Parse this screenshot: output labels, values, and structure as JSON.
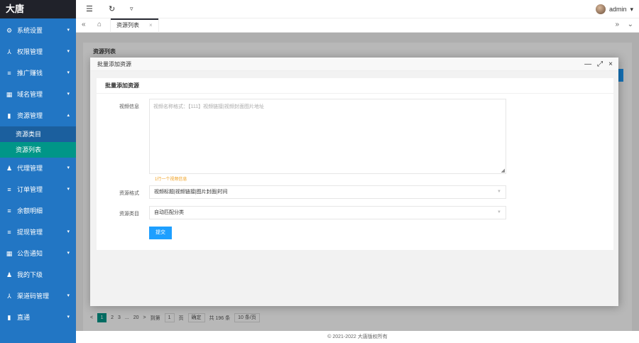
{
  "app": {
    "logo": "大唐"
  },
  "sidebar": {
    "items": [
      {
        "label": "系统设置",
        "icon": "gear-icon",
        "glyph": "⚙",
        "arrow": "▾"
      },
      {
        "label": "权限管理",
        "icon": "users-icon",
        "glyph": "⅄",
        "arrow": "▾"
      },
      {
        "label": "推广赚钱",
        "icon": "list-icon",
        "glyph": "≡",
        "arrow": "▾"
      },
      {
        "label": "域名管理",
        "icon": "grid-icon",
        "glyph": "▦",
        "arrow": "▾"
      },
      {
        "label": "资源管理",
        "icon": "file-icon",
        "glyph": "▮",
        "arrow": "▴"
      },
      {
        "label": "代理管理",
        "icon": "person-icon",
        "glyph": "♟",
        "arrow": "▾"
      },
      {
        "label": "订单管理",
        "icon": "list-icon",
        "glyph": "≡",
        "arrow": "▾"
      },
      {
        "label": "余额明细",
        "icon": "list-icon",
        "glyph": "≡",
        "arrow": ""
      },
      {
        "label": "提现管理",
        "icon": "list-icon",
        "glyph": "≡",
        "arrow": "▾"
      },
      {
        "label": "公告通知",
        "icon": "apps-icon",
        "glyph": "▦",
        "arrow": "▾"
      },
      {
        "label": "我的下级",
        "icon": "person-icon",
        "glyph": "♟",
        "arrow": ""
      },
      {
        "label": "渠道码管理",
        "icon": "users-icon",
        "glyph": "⅄",
        "arrow": "▾"
      },
      {
        "label": "直通",
        "icon": "file-icon",
        "glyph": "▮",
        "arrow": "▾"
      }
    ],
    "sub_items": [
      {
        "label": "资源类目"
      },
      {
        "label": "资源列表"
      }
    ]
  },
  "header": {
    "menu_glyph": "☰",
    "refresh_glyph": "↻",
    "clear_glyph": "▿",
    "user": "admin",
    "user_caret": "▾"
  },
  "tabs": {
    "prev_glyph": "«",
    "home_glyph": "⌂",
    "next_glyph": "»",
    "more_glyph": "⌄",
    "active": {
      "label": "资源列表",
      "close": "×"
    }
  },
  "background": {
    "title": "资源列表",
    "pager": {
      "prev": "<",
      "pages": [
        "1",
        "2",
        "3",
        "...",
        "20"
      ],
      "next": ">",
      "goto_label": "到第",
      "goto_value": "1",
      "page_unit": "页",
      "confirm": "确定",
      "total": "共 196 条",
      "page_size": "10 条/页"
    }
  },
  "footer": {
    "text": "© 2021-2022 大唐版权所有"
  },
  "modal": {
    "title": "批量添加资源",
    "tools": {
      "minimize": "—",
      "maximize": "⤢",
      "close": "×"
    },
    "form": {
      "title": "批量添加资源",
      "video_label": "视频信息",
      "video_placeholder": "视频名称格式：【111】视频链接|视频封面图片地址",
      "hint": "1行一个视频信息",
      "format_label": "资源格式",
      "format_value": "视频标题|视频链接|图片封面|时间",
      "category_label": "资源类目",
      "category_value": "自动匹配分类",
      "caret": "▼",
      "submit": "提交"
    }
  }
}
